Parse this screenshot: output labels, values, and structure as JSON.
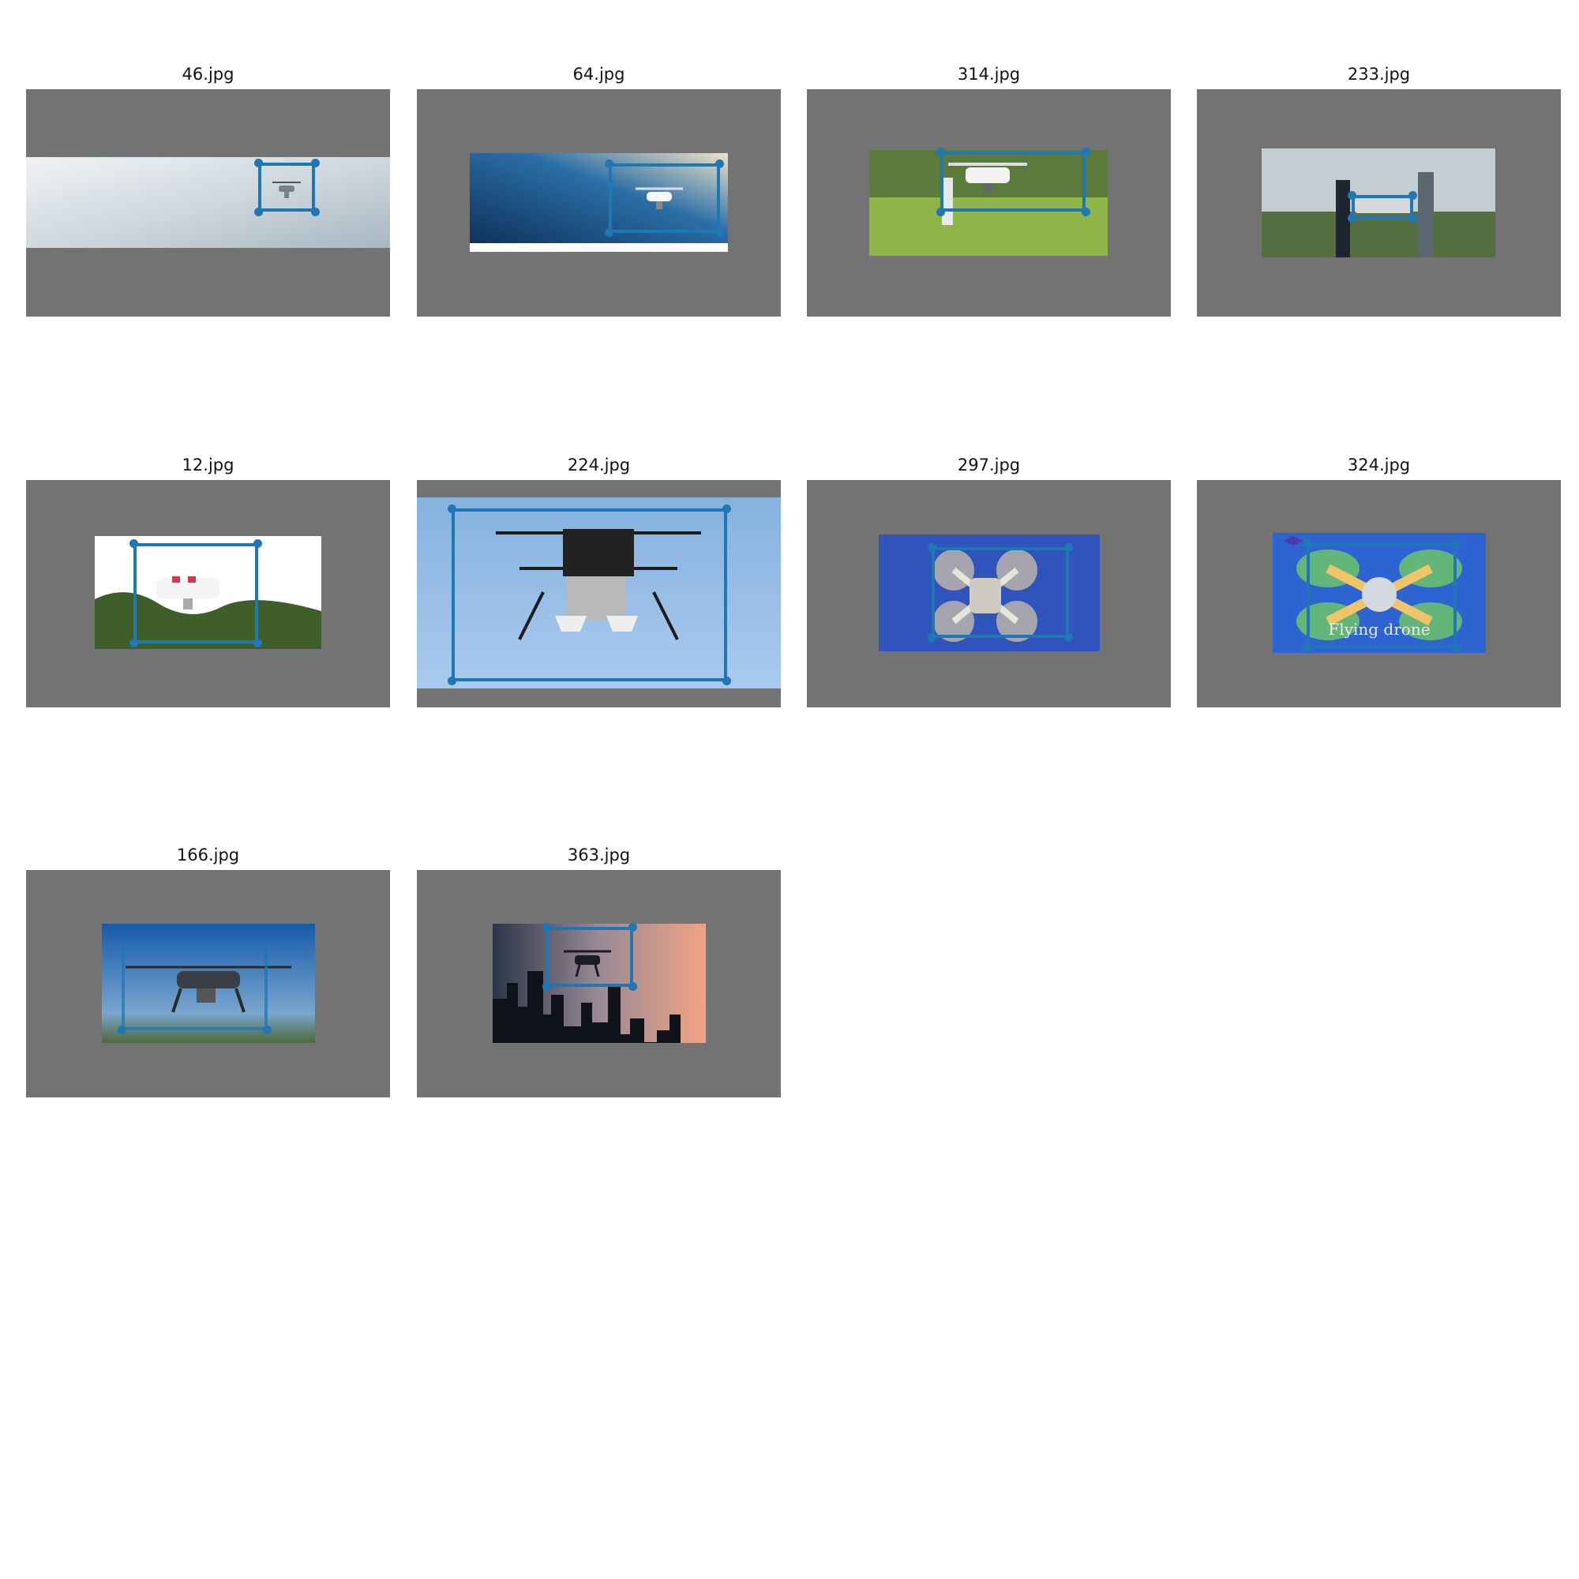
{
  "gallery": {
    "panel_color": "#737373",
    "box_color": "#1f77b4",
    "items": [
      {
        "filename": "46.jpg",
        "scene": "drone-sky-blur",
        "photo_colors": [
          "#dfe4e8",
          "#aab8c2"
        ]
      },
      {
        "filename": "64.jpg",
        "scene": "drone-ocean-blue",
        "photo_colors": [
          "#1b4f7f",
          "#e9dcc2"
        ]
      },
      {
        "filename": "314.jpg",
        "scene": "drone-grass-person",
        "photo_colors": [
          "#4a6a30",
          "#9bbd4a"
        ]
      },
      {
        "filename": "233.jpg",
        "scene": "drone-field-two-people",
        "photo_colors": [
          "#b9c3c9",
          "#4f6a3a"
        ]
      },
      {
        "filename": "12.jpg",
        "scene": "drone-trees-white",
        "photo_colors": [
          "#ffffff",
          "#3d5a2a"
        ]
      },
      {
        "filename": "224.jpg",
        "scene": "drone-large-sky",
        "photo_colors": [
          "#8ab4e0",
          "#a9c9ec"
        ]
      },
      {
        "filename": "297.jpg",
        "scene": "drone-top-view-blue",
        "photo_colors": [
          "#2c4fb3",
          "#4a74d6"
        ]
      },
      {
        "filename": "324.jpg",
        "scene": "drone-graphic-flying",
        "photo_colors": [
          "#2c5fd1",
          "#6fc6f0"
        ],
        "overlay_text": "Flying drone"
      },
      {
        "filename": "166.jpg",
        "scene": "drone-blue-sky-black",
        "photo_colors": [
          "#1a62b0",
          "#6fa0cc"
        ]
      },
      {
        "filename": "363.jpg",
        "scene": "drone-city-sunset",
        "photo_colors": [
          "#2b3547",
          "#e8a085"
        ]
      }
    ]
  }
}
